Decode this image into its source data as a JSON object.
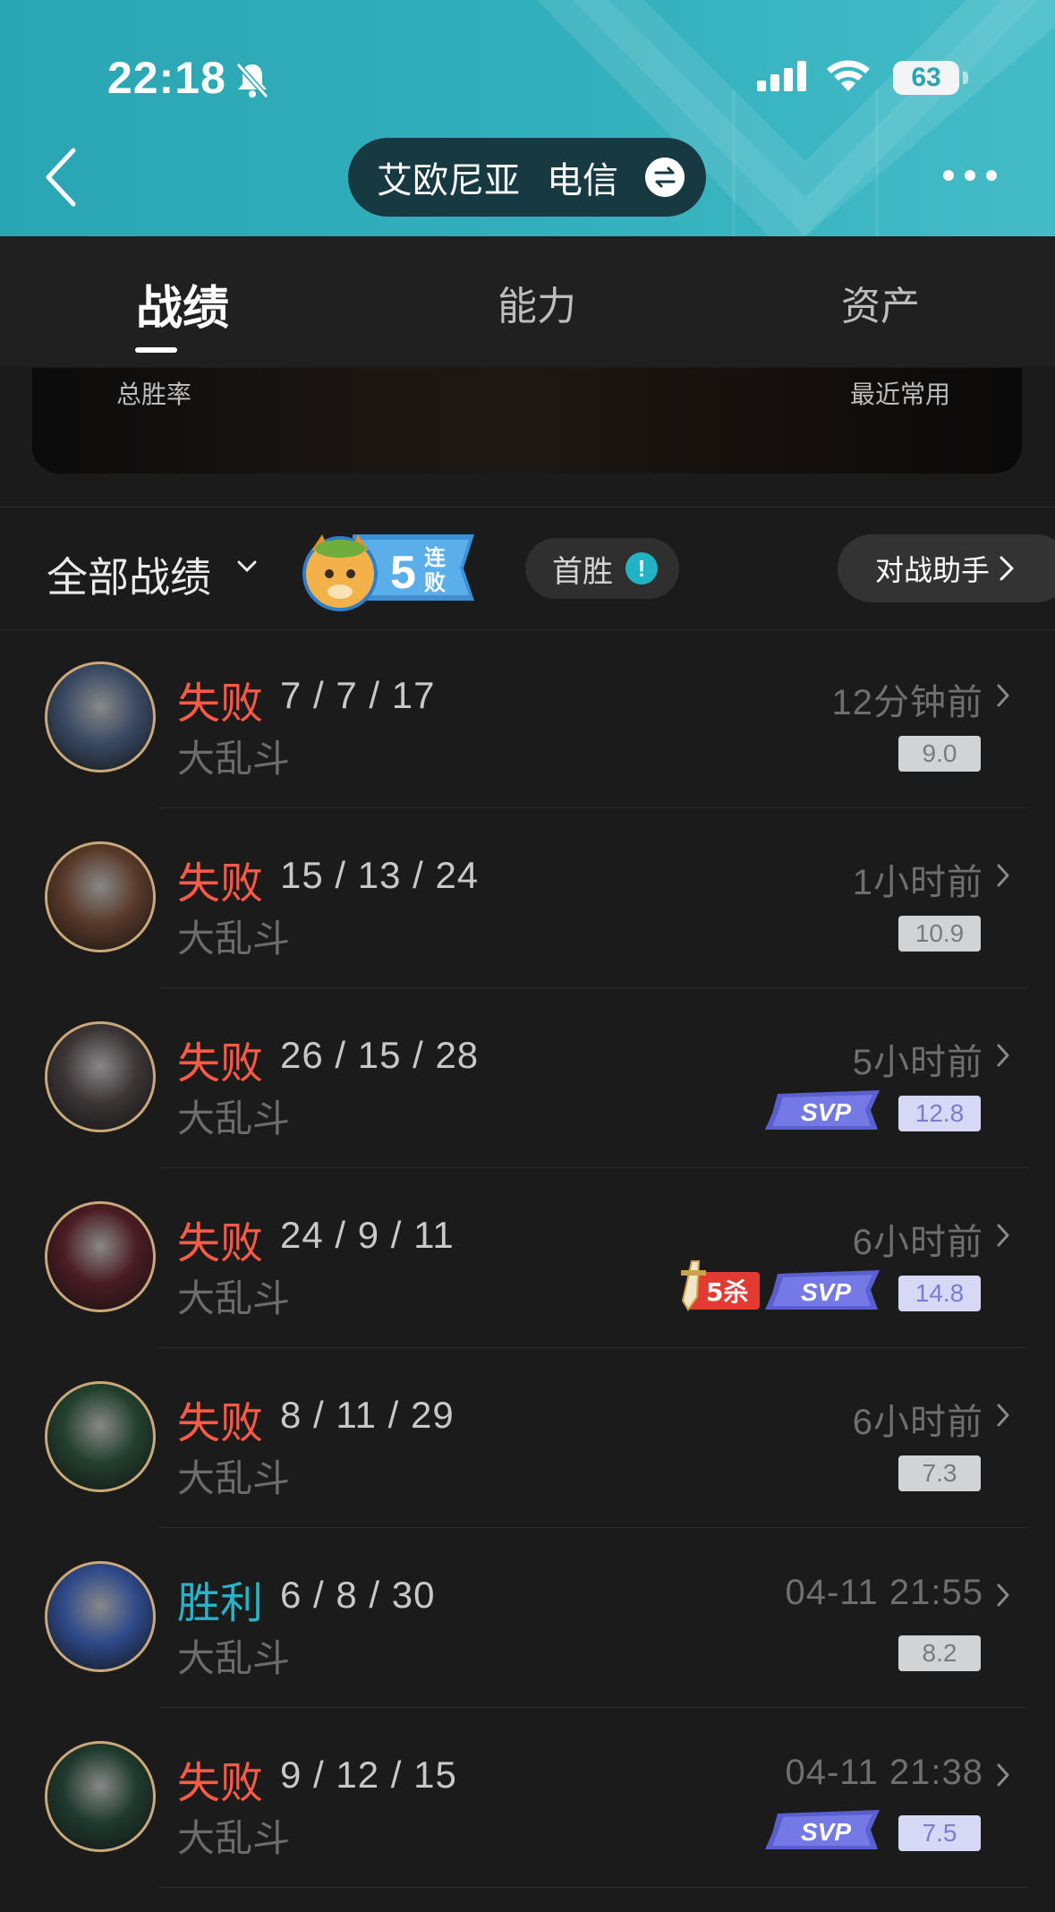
{
  "status_bar": {
    "time": "22:18",
    "battery": "63"
  },
  "header": {
    "server": "艾欧尼亚",
    "isp": "电信"
  },
  "tabs": [
    {
      "label": "战绩",
      "active": true
    },
    {
      "label": "能力",
      "active": false
    },
    {
      "label": "资产",
      "active": false
    }
  ],
  "summary": {
    "left_label": "总胜率",
    "right_label": "最近常用"
  },
  "filter": {
    "title": "全部战绩",
    "streak_number": "5",
    "streak_text_1": "连",
    "streak_text_2": "败",
    "first_win": "首胜",
    "first_win_info": "!",
    "assistant": "对战助手"
  },
  "colors": {
    "header_teal": "#2aa5b3",
    "loss": "#ff5a45",
    "win": "#27b4c8",
    "score_gray": "#d1d3d4",
    "score_purple": "#d6d8f5"
  },
  "matches": [
    {
      "result": "失败",
      "outcome": "loss",
      "kda": "7 / 7 / 17",
      "mode": "大乱斗",
      "time": "12分钟前",
      "score": "9.0",
      "score_style": "gray",
      "svp": false,
      "svp_label": "",
      "penta": false,
      "penta_label": "",
      "avatar_color": "#3a4a64"
    },
    {
      "result": "失败",
      "outcome": "loss",
      "kda": "15 / 13 / 24",
      "mode": "大乱斗",
      "time": "1小时前",
      "score": "10.9",
      "score_style": "gray",
      "svp": false,
      "svp_label": "",
      "penta": false,
      "penta_label": "",
      "avatar_color": "#5a3a2a"
    },
    {
      "result": "失败",
      "outcome": "loss",
      "kda": "26 / 15 / 28",
      "mode": "大乱斗",
      "time": "5小时前",
      "score": "12.8",
      "score_style": "purple",
      "svp": true,
      "svp_label": "SVP",
      "penta": false,
      "penta_label": "",
      "avatar_color": "#3c3536"
    },
    {
      "result": "失败",
      "outcome": "loss",
      "kda": "24 / 9 / 11",
      "mode": "大乱斗",
      "time": "6小时前",
      "score": "14.8",
      "score_style": "purple",
      "svp": true,
      "svp_label": "SVP",
      "penta": true,
      "penta_label": "5杀",
      "avatar_color": "#4a1c22"
    },
    {
      "result": "失败",
      "outcome": "loss",
      "kda": "8 / 11 / 29",
      "mode": "大乱斗",
      "time": "6小时前",
      "score": "7.3",
      "score_style": "gray",
      "svp": false,
      "svp_label": "",
      "penta": false,
      "penta_label": "",
      "avatar_color": "#23402e"
    },
    {
      "result": "胜利",
      "outcome": "win",
      "kda": "6 / 8 / 30",
      "mode": "大乱斗",
      "time": "04-11 21:55",
      "score": "8.2",
      "score_style": "gray",
      "svp": false,
      "svp_label": "",
      "penta": false,
      "penta_label": "",
      "avatar_color": "#2e4a8a"
    },
    {
      "result": "失败",
      "outcome": "loss",
      "kda": "9 / 12 / 15",
      "mode": "大乱斗",
      "time": "04-11 21:38",
      "score": "7.5",
      "score_style": "purple",
      "svp": true,
      "svp_label": "SVP",
      "penta": false,
      "penta_label": "",
      "avatar_color": "#1f3a2e"
    }
  ]
}
